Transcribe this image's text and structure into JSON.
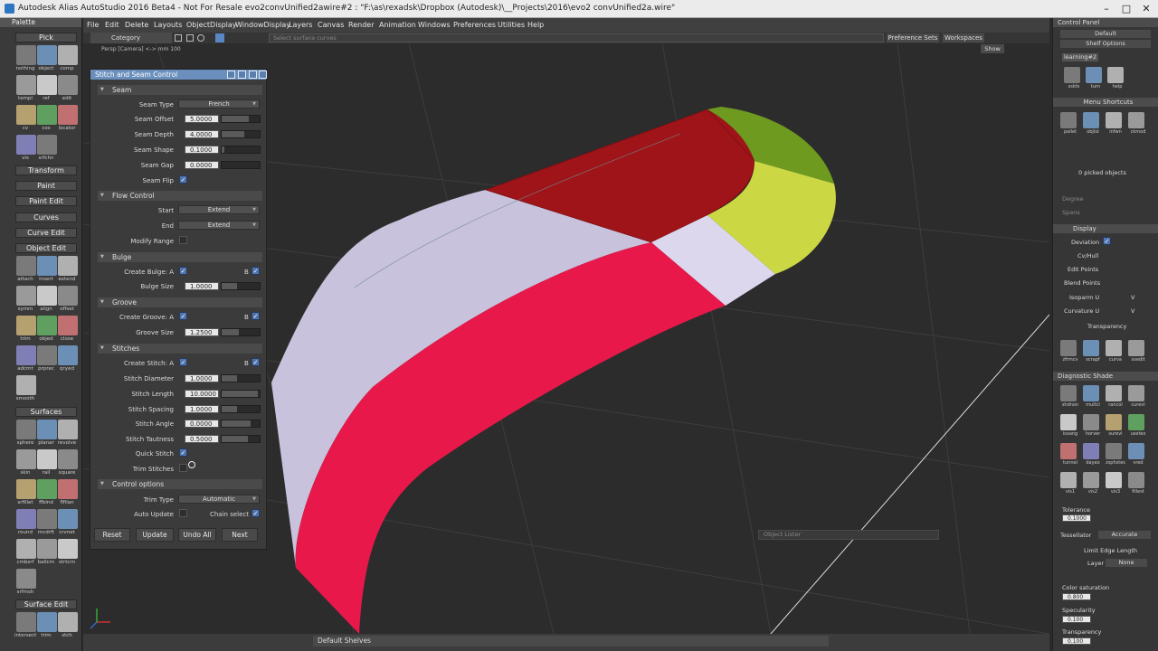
{
  "window": {
    "title": "Autodesk Alias AutoStudio 2016 Beta4 - Not For Resale  evo2convUnified2awire#2 : \"F:\\as\\rexadsk\\Dropbox (Autodesk)\\__Projects\\2016\\evo2 convUnified2a.wire\"",
    "minimize": "–",
    "maximize": "□",
    "close": "✕"
  },
  "menu": [
    "File",
    "Edit",
    "Delete",
    "Layouts",
    "ObjectDisplay",
    "WindowDisplay",
    "Layers",
    "Canvas",
    "Render",
    "Animation",
    "Windows",
    "Preferences",
    "Utilities",
    "Help"
  ],
  "toolbar": {
    "category": "Category",
    "search_placeholder": "Select surface curves",
    "preference_sets": "Preference Sets",
    "workspaces": "Workspaces",
    "show": "Show"
  },
  "viewport": {
    "label": "Persp [Camera] <-> mm    100"
  },
  "palette": {
    "title": "Palette",
    "sections": [
      "Pick",
      "Transform",
      "Paint",
      "Paint Edit",
      "Curves",
      "Curve Edit",
      "Object Edit",
      "Surfaces",
      "Surface Edit"
    ],
    "pick_icons": [
      "nothing",
      "object",
      "comp",
      "templ",
      "ref",
      "edit",
      "cv",
      "cos",
      "locator",
      "vis",
      "srfchn"
    ],
    "objedit_icons": [
      "attach",
      "insert",
      "extend",
      "symm",
      "align",
      "offset",
      "trim",
      "objed",
      "close",
      "adcmt",
      "prprec",
      "qryed",
      "smooth"
    ],
    "surf_icons": [
      "sphere",
      "planar",
      "revolve",
      "skin",
      "rail",
      "square",
      "srfillet",
      "ffblnd",
      "flfilan",
      "round",
      "mcdrft",
      "crvnet",
      "cmbsrf",
      "ballcrn",
      "strtcrn",
      "srfmsh"
    ],
    "surfedit_icons": [
      "intersect",
      "trim",
      "stch"
    ]
  },
  "dialog": {
    "title": "Stitch and Seam Control",
    "seam": {
      "header": "Seam",
      "type_label": "Seam Type",
      "type_value": "French",
      "offset_label": "Seam Offset",
      "offset_value": "5.0000",
      "offset_fill": 0.72,
      "depth_label": "Seam Depth",
      "depth_value": "4.0000",
      "depth_fill": 0.6,
      "shape_label": "Seam Shape",
      "shape_value": "0.1000",
      "shape_fill": 0.08,
      "gap_label": "Seam Gap",
      "gap_value": "0.0000",
      "gap_fill": 0.0,
      "flip_label": "Seam Flip",
      "flip_checked": true
    },
    "flow": {
      "header": "Flow Control",
      "start_label": "Start",
      "start_value": "Extend",
      "end_label": "End",
      "end_value": "Extend",
      "range_label": "Modify Range",
      "range_checked": false
    },
    "bulge": {
      "header": "Bulge",
      "create_label": "Create Bulge: A",
      "a_checked": true,
      "b_label": "B",
      "b_checked": true,
      "size_label": "Bulge Size",
      "size_value": "1.0000",
      "size_fill": 0.4
    },
    "groove": {
      "header": "Groove",
      "create_label": "Create Groove: A",
      "a_checked": true,
      "b_label": "B",
      "b_checked": true,
      "size_label": "Groove Size",
      "size_value": "1.2500",
      "size_fill": 0.45
    },
    "stitches": {
      "header": "Stitches",
      "create_label": "Create Stitch: A",
      "a_checked": true,
      "b_label": "B",
      "b_checked": true,
      "diameter_label": "Stitch Diameter",
      "diameter_value": "1.0000",
      "diameter_fill": 0.4,
      "length_label": "Stitch Length",
      "length_value": "10.0000",
      "length_fill": 0.95,
      "spacing_label": "Stitch Spacing",
      "spacing_value": "1.0000",
      "spacing_fill": 0.4,
      "angle_label": "Stitch Angle",
      "angle_value": "0.0000",
      "angle_fill": 0.75,
      "tautness_label": "Stitch Tautness",
      "tautness_value": "0.5000",
      "tautness_fill": 0.7,
      "quick_label": "Quick Stitch",
      "quick_checked": true,
      "trim_label": "Trim Stitches",
      "trim_checked": false
    },
    "control": {
      "header": "Control options",
      "trim_type_label": "Trim Type",
      "trim_type_value": "Automatic",
      "auto_update_label": "Auto Update",
      "auto_update_checked": false,
      "chain_label": "Chain select",
      "chain_checked": true
    },
    "buttons": {
      "reset": "Reset",
      "update": "Update",
      "undo_all": "Undo All",
      "next": "Next"
    }
  },
  "control_panel": {
    "title": "Control Panel",
    "default": "Default",
    "shelf_options": "Shelf Options",
    "shelf_tab": "learning#2",
    "shelf_icons": [
      "sskts",
      "turn",
      "help"
    ],
    "menu_shortcuts": "Menu Shortcuts",
    "shortcut_icons": [
      "pallet",
      "objlst",
      "infwn",
      "ckmod"
    ],
    "picked": "0 picked objects",
    "degree": "Degree",
    "spans": "Spans",
    "display_header": "Display",
    "deviation": "Deviation",
    "deviation_checked": true,
    "cvhull": "Cv/Hull",
    "edit_points": "Edit Points",
    "blend_points": "Blend Points",
    "isoparm": "Isoparm U",
    "isoparm_v": "V",
    "curvature": "Curvature U",
    "curvature_v": "V",
    "transparency": "Transparency",
    "tool_icons": [
      "zfrmcv",
      "scrapf",
      "curva",
      "xsedit"
    ],
    "diag_header": "Diagnostic Shade",
    "diag_icons": [
      "shdnon",
      "multcl",
      "rancol",
      "curevl",
      "isoang",
      "horver",
      "surevl",
      "usetex",
      "tunnel",
      "dayao",
      "zsphstes",
      "vred",
      "vis1",
      "vis2",
      "vis3",
      "fillest"
    ],
    "tolerance_label": "Tolerance",
    "tolerance_value": "0.1000",
    "tessellator_label": "Tessellator",
    "tessellator_value": "Accurate",
    "limit_edge": "Limit Edge Length",
    "layer_label": "Layer",
    "layer_value": "None",
    "color_sat_label": "Color saturation",
    "color_sat_value": "0.800",
    "specularity_label": "Specularity",
    "specularity_value": "0.100",
    "transparency_label": "Transparency",
    "transparency_value": "0.100"
  },
  "bottom": {
    "shelves": "Default Shelves",
    "object_lister": "Object Lister"
  }
}
